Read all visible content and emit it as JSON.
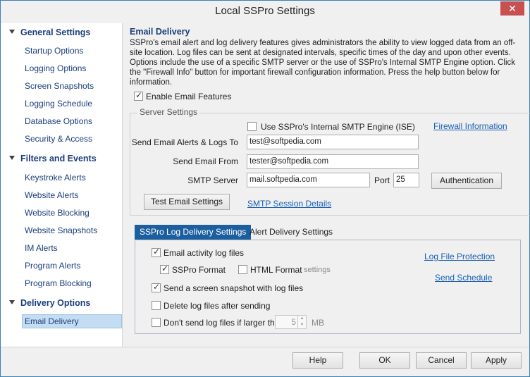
{
  "window": {
    "title": "Local SSPro Settings",
    "close_glyph": "✕"
  },
  "sidebar": {
    "groups": [
      {
        "label": "General Settings",
        "items": [
          "Startup Options",
          "Logging Options",
          "Screen Snapshots",
          "Logging Schedule",
          "Database Options",
          "Security & Access"
        ]
      },
      {
        "label": "Filters and Events",
        "items": [
          "Keystroke Alerts",
          "Website Alerts",
          "Website Blocking",
          "Website Snapshots",
          "IM Alerts",
          "Program Alerts",
          "Program Blocking"
        ]
      },
      {
        "label": "Delivery Options",
        "items": [
          "Email Delivery"
        ]
      }
    ],
    "selected": "Email Delivery"
  },
  "main": {
    "header": "Email Delivery",
    "description": "SSPro's email alert and log delivery features gives administrators the ability to view logged data from an off-site location. Log files can be sent at designated intervals, specific times of the day and upon other events. Options include the use of a specific SMTP server or the use of SSPro's Internal SMTP Engine option. Click the \"Firewall Info\" button for important firewall configuration information. Press the help button below for information.",
    "enable_email": {
      "label": "Enable Email Features",
      "checked": true
    },
    "server_settings": {
      "legend": "Server Settings",
      "use_internal_smtp": {
        "label": "Use SSPro's Internal SMTP Engine (ISE)",
        "checked": false
      },
      "firewall_link": "Firewall Information",
      "send_alerts_to": {
        "label": "Send Email Alerts & Logs To",
        "value": "test@softpedia.com"
      },
      "send_from": {
        "label": "Send Email From",
        "value": "tester@softpedia.com"
      },
      "smtp_server": {
        "label": "SMTP Server",
        "value": "mail.softpedia.com"
      },
      "port": {
        "label": "Port",
        "value": "25"
      },
      "authentication_button": "Authentication",
      "test_button": "Test Email Settings",
      "session_link": "SMTP Session Details"
    },
    "tabs": [
      {
        "label": "SSPro Log Delivery Settings",
        "active": true
      },
      {
        "label": "Alert Delivery Settings",
        "active": false
      }
    ],
    "log_delivery": {
      "email_activity": {
        "label": "Email activity log files",
        "checked": true
      },
      "sspro_format": {
        "label": "SSPro Format",
        "checked": true
      },
      "html_format": {
        "label": "HTML Format",
        "checked": false
      },
      "settings_link": "settings",
      "send_snapshot": {
        "label": "Send a screen snapshot with log files",
        "checked": true
      },
      "delete_after": {
        "label": "Delete log files after sending",
        "checked": false
      },
      "dont_send_larger": {
        "label": "Don't send log files if larger than",
        "checked": false
      },
      "size_value": "5",
      "size_unit": "MB",
      "protection_link": "Log File Protection",
      "schedule_link": "Send Schedule"
    }
  },
  "footer": {
    "help": "Help",
    "ok": "OK",
    "cancel": "Cancel",
    "apply": "Apply"
  }
}
